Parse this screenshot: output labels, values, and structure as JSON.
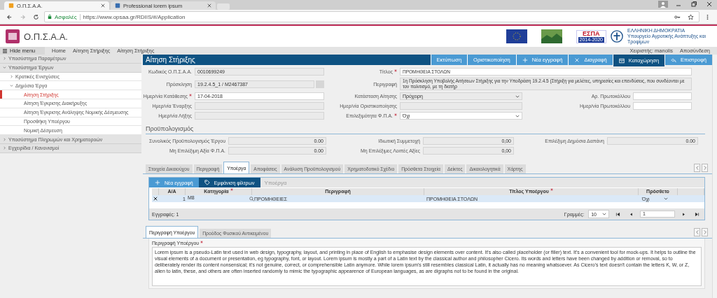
{
  "browser": {
    "tabs": [
      {
        "title": "Ο.Π.Σ.Α.Α.",
        "selected": true
      },
      {
        "title": "Professional lorem ipsum",
        "selected": false
      }
    ],
    "secure_label": "Ασφαλές",
    "url": "https://www.opsaa.gr/RDIIS/#/Application"
  },
  "header": {
    "logo_text": "Ο.Π.Σ.Α.Α.",
    "espa_title": "ΕΣΠΑ",
    "espa_years": "2014-2020",
    "ministry_title": "ΕΛΛΗΝΙΚΗ ΔΗΜΟΚΡΑΤΙΑ",
    "ministry_name": "Υπουργείο Αγροτικής Ανάπτυξης και Τροφίμων"
  },
  "nav": {
    "hide_menu": "Hide menu",
    "links": [
      "Home",
      "Αίτηση Στήριξης",
      "Αίτηση Στήριξης"
    ],
    "user_label": "Χειριστής:",
    "user": "manolis",
    "logout": "Αποσύνδεση"
  },
  "sidebar": {
    "items": [
      {
        "label": "Υποσύστημα Παραμέτρων",
        "expanded": false,
        "selected": false
      },
      {
        "label": "Υποσύστημα Έργων",
        "expanded": true,
        "selected": false,
        "children": [
          {
            "label": "Κρατικές Ενισχύσεις",
            "expanded": false,
            "selected": false
          },
          {
            "label": "Δημόσια Έργα",
            "expanded": true,
            "selected": false,
            "children": [
              {
                "label": "Αίτηση Στήριξης",
                "selected": true
              },
              {
                "label": "Αίτηση Έγκρισης Διακήρυξης",
                "selected": false
              },
              {
                "label": "Αίτηση Έγκρισης Ανάληψης Νομικής Δέσμευσης",
                "selected": false
              },
              {
                "label": "Προσθήκη Υποέργου",
                "selected": false
              },
              {
                "label": "Νομική Δέσμευση",
                "selected": false
              }
            ]
          }
        ]
      },
      {
        "label": "Υποσύστημα Πληρωμών και Χρηματοροών",
        "expanded": false,
        "selected": false
      },
      {
        "label": "Εγχειρίδια / Κανονισμοί",
        "expanded": false,
        "selected": false
      }
    ]
  },
  "page_title": "Αίτηση Στήριξης",
  "actions": [
    {
      "label": "Εκτύπωση",
      "kind": "plain",
      "primary": false
    },
    {
      "label": "Οριστικοποίηση",
      "kind": "plain",
      "primary": false
    },
    {
      "label": "Νέα εγγραφή",
      "kind": "plus",
      "primary": false
    },
    {
      "label": "Διαγραφή",
      "kind": "delete",
      "primary": false
    },
    {
      "label": "Καταχώρηση",
      "kind": "save",
      "primary": true
    },
    {
      "label": "Επιστροφή",
      "kind": "back",
      "primary": false
    }
  ],
  "form": {
    "rows": [
      {
        "left": {
          "label": "Κωδικός Ο.Π.Σ.Α.Α.",
          "value": "0010699249",
          "required": false,
          "disabled": true,
          "kind": "text"
        },
        "middle": {
          "label": "Τίτλος",
          "value": "ΠΡΟΜΗΘΕΙΑ ΣΤΟΛΩΝ",
          "required": true,
          "disabled": false,
          "kind": "wide"
        }
      },
      {
        "left": {
          "label": "Πρόσκληση",
          "value": "19.2.4.5_1 / M2467387",
          "required": false,
          "disabled": true,
          "kind": "lookup"
        },
        "middle": {
          "label": "Περιγραφή",
          "value": "1η Πρόσκληση Υποβολής Αιτήσεων Στήριξης για την Υποδράση 19.2.4.5 (Στήριξη για μελέτες, υπηρεσίες και επενδύσεις, που συνδέονται με τον πολιτισμό, με τη διατήρ",
          "required": false,
          "disabled": true,
          "kind": "wide"
        }
      },
      {
        "left": {
          "label": "Ημερ/νία Κατάθεσης",
          "value": "17-04-2018",
          "required": true,
          "disabled": false,
          "kind": "text"
        },
        "middle": {
          "label": "Κατάσταση Αίτησης",
          "value": "Πρόχειρη",
          "required": false,
          "disabled": true,
          "kind": "select"
        },
        "right": {
          "label": "Αρ. Πρωτοκόλλου",
          "required": false,
          "disabled": false,
          "kind": "text"
        }
      },
      {
        "left": {
          "label": "Ημερ/νία Έναρξης",
          "required": false,
          "disabled": true,
          "kind": "text"
        },
        "middle": {
          "label": "Ημερ/νία Οριστικοποίησης",
          "required": false,
          "disabled": true,
          "kind": "text"
        },
        "right": {
          "label": "Ημερ/νία Πρωτοκόλλου",
          "required": false,
          "disabled": false,
          "kind": "text"
        }
      },
      {
        "left": {
          "label": "Ημερ/νία Λήξης",
          "required": false,
          "disabled": true,
          "kind": "text"
        },
        "middle": {
          "label": "Επιλεξιμότητα Φ.Π.Α.",
          "value": "Όχι",
          "required": true,
          "disabled": false,
          "kind": "select"
        }
      }
    ]
  },
  "budget": {
    "title": "Προϋπολογισμός",
    "rows": [
      {
        "left": {
          "label": "Συνολικός Προϋπολογισμός Έργου",
          "value": "0.00"
        },
        "middle": {
          "label": "Ιδιωτική Συμμετοχή",
          "value": "0,00"
        },
        "right": {
          "label": "Επιλέξιμη Δημόσια Δαπάνη",
          "value": "0.00"
        }
      },
      {
        "left": {
          "label": "Μη Επιλέξιμη Αξία Φ.Π.Α.",
          "value": "0.00"
        },
        "middle": {
          "label": "Μη Επιλέξιμες Λοιπές Αξίες",
          "value": "0,00"
        }
      }
    ]
  },
  "tabs": [
    {
      "label": "Στοιχεία Δικαιούχου",
      "selected": false
    },
    {
      "label": "Περιγραφή",
      "selected": false
    },
    {
      "label": "Υποέργα",
      "selected": true
    },
    {
      "label": "Αποφάσεις",
      "selected": false
    },
    {
      "label": "Ανάλυση Προϋπολογισμού",
      "selected": false
    },
    {
      "label": "Χρηματοδοτικό Σχέδιο",
      "selected": false
    },
    {
      "label": "Πρόσθετα Στοιχεία",
      "selected": false
    },
    {
      "label": "Δείκτες",
      "selected": false
    },
    {
      "label": "Δικαιολογητικά",
      "selected": false
    },
    {
      "label": "Χάρτης",
      "selected": false
    }
  ],
  "grid": {
    "new_button": "Νέα εγγραφή",
    "filter_button": "Εμφάνιση φίλτρων",
    "title": "Υποέργα",
    "columns": [
      {
        "label": "Α/Α",
        "required": false
      },
      {
        "label": "Κατηγορία",
        "required": true
      },
      {
        "label": "Περιγραφή",
        "required": false
      },
      {
        "label": "Τίτλος Υποέργου",
        "required": true
      },
      {
        "label": "Πρόσθετο",
        "required": false
      }
    ],
    "rows": [
      {
        "number": "1",
        "category": "M8",
        "description": "ΠΡΟΜΗΘΕΙΕΣ",
        "title": "ΠΡΟΜΗΘΕΙΑ ΣΤΟΛΩΝ",
        "additional": "Όχι"
      }
    ],
    "records": "Εγγραφές: 1",
    "rows_label": "Γραμμές:",
    "rows_value": "10",
    "page": "1"
  },
  "subtabs": [
    {
      "label": "Περιγραφή Υποέργου",
      "selected": true
    },
    {
      "label": "Προόδος Φυσικού Αντικειμένου",
      "selected": false
    }
  ],
  "description": {
    "label": "Περιγραφή Υποέργου",
    "required": true,
    "value": "Lorem ipsum is a pseudo-Latin text used in web design, typography, layout, and printing in place of English to emphasise design elements over content. It's also called placeholder (or filler) text. It's a convenient tool for mock-ups. It helps to outline the visual elements of a document or presentation, eg typography, font, or layout. Lorem ipsum is mostly a part of a Latin text by the classical author and philosopher Cicero. Its words and letters have been changed by addition or removal, so to deliberately render its content nonsensical; it's not genuine, correct, or comprehensible Latin anymore. While lorem ipsum's still resembles classical Latin, it actually has no meaning whatsoever. As Cicero's text doesn't contain the letters K, W, or Z, alien to latin, these, and others are often inserted randomly to mimic the typographic appearence of European languages, as are digraphs not to be found in the original."
  }
}
